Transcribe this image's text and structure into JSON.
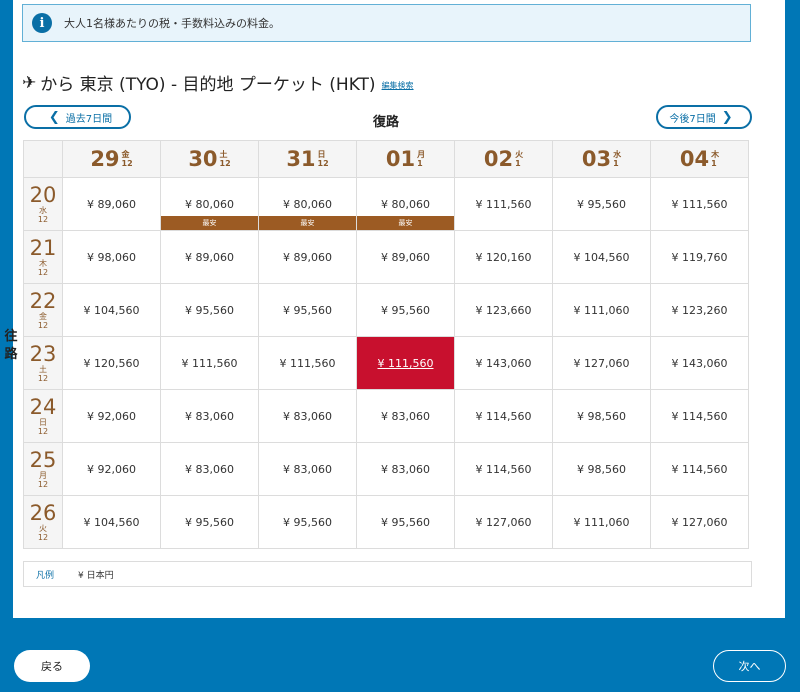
{
  "notice": {
    "text": "大人1名様あたりの税・手数料込みの料金。",
    "icon": "i"
  },
  "route": {
    "plane_icon": "✈",
    "title": "から 東京 (TYO) - 目的地 プーケット (HKT)",
    "edit_link": "編集検索"
  },
  "nav": {
    "prev_label": "過去7日間",
    "next_label": "今後7日間",
    "prev_icon": "❮",
    "next_icon": "❯"
  },
  "return_label": "復路",
  "outbound_label": "往路",
  "columns": [
    {
      "day": "29",
      "dow": "金",
      "month": "12"
    },
    {
      "day": "30",
      "dow": "土",
      "month": "12"
    },
    {
      "day": "31",
      "dow": "日",
      "month": "12"
    },
    {
      "day": "01",
      "dow": "月",
      "month": "1"
    },
    {
      "day": "02",
      "dow": "火",
      "month": "1"
    },
    {
      "day": "03",
      "dow": "水",
      "month": "1"
    },
    {
      "day": "04",
      "dow": "木",
      "month": "1"
    }
  ],
  "rows": [
    {
      "day": "20",
      "dow": "水",
      "month": "12",
      "prices": [
        "¥ 89,060",
        "¥ 80,060",
        "¥ 80,060",
        "¥ 80,060",
        "¥ 111,560",
        "¥ 95,560",
        "¥ 111,560"
      ],
      "tags": [
        "",
        "最安",
        "最安",
        "最安",
        "",
        "",
        ""
      ]
    },
    {
      "day": "21",
      "dow": "木",
      "month": "12",
      "prices": [
        "¥ 98,060",
        "¥ 89,060",
        "¥ 89,060",
        "¥ 89,060",
        "¥ 120,160",
        "¥ 104,560",
        "¥ 119,760"
      ]
    },
    {
      "day": "22",
      "dow": "金",
      "month": "12",
      "prices": [
        "¥ 104,560",
        "¥ 95,560",
        "¥ 95,560",
        "¥ 95,560",
        "¥ 123,660",
        "¥ 111,060",
        "¥ 123,260"
      ]
    },
    {
      "day": "23",
      "dow": "土",
      "month": "12",
      "prices": [
        "¥ 120,560",
        "¥ 111,560",
        "¥ 111,560",
        "¥ 111,560",
        "¥ 143,060",
        "¥ 127,060",
        "¥ 143,060"
      ],
      "selected": 3
    },
    {
      "day": "24",
      "dow": "日",
      "month": "12",
      "prices": [
        "¥ 92,060",
        "¥ 83,060",
        "¥ 83,060",
        "¥ 83,060",
        "¥ 114,560",
        "¥ 98,560",
        "¥ 114,560"
      ]
    },
    {
      "day": "25",
      "dow": "月",
      "month": "12",
      "prices": [
        "¥ 92,060",
        "¥ 83,060",
        "¥ 83,060",
        "¥ 83,060",
        "¥ 114,560",
        "¥ 98,560",
        "¥ 114,560"
      ]
    },
    {
      "day": "26",
      "dow": "火",
      "month": "12",
      "prices": [
        "¥ 104,560",
        "¥ 95,560",
        "¥ 95,560",
        "¥ 95,560",
        "¥ 127,060",
        "¥ 111,060",
        "¥ 127,060"
      ]
    }
  ],
  "legend": {
    "title": "凡例",
    "text": "¥ 日本円"
  },
  "buttons": {
    "back": "戻る",
    "next": "次へ"
  },
  "colors": {
    "brand_blue": "#0077b6",
    "accent_brown": "#9c5b23",
    "selected_red": "#c8102e"
  }
}
